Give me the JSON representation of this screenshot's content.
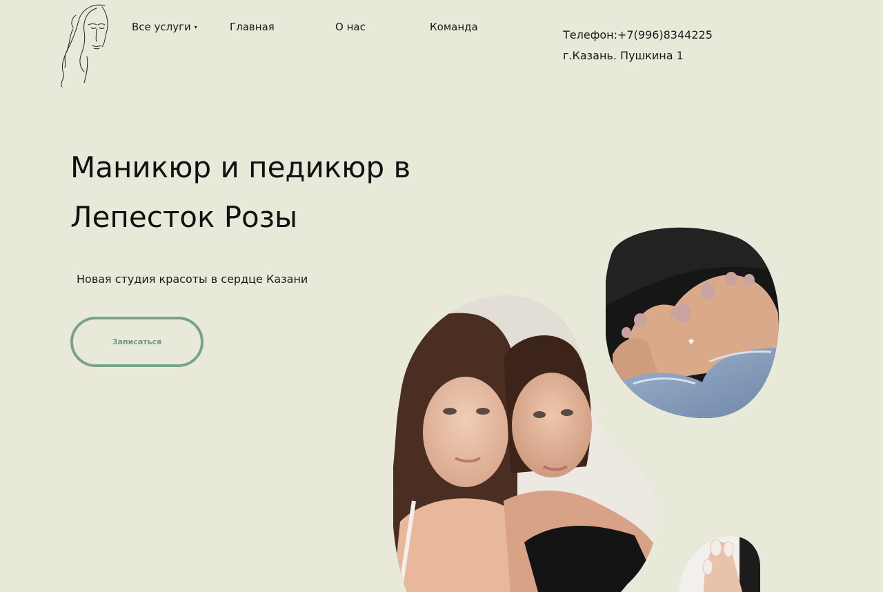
{
  "header": {
    "logo_icon": "face-line-art-logo",
    "nav": {
      "services_label": "Все услуги",
      "services_caret": "▾",
      "home_label": "Главная",
      "about_label": "О нас",
      "team_label": "Команда"
    },
    "contact": {
      "phone": "Телефон:+7(996)8344225",
      "address": "г.Казань. Пушкина 1"
    }
  },
  "hero": {
    "title_line1": "Маникюр и педикюр в",
    "title_line2": "Лепесток Розы",
    "subtitle": "Новая студия красоты в сердце Казани",
    "cta_label": "Записаться"
  },
  "images": [
    {
      "name": "pedicure-photo",
      "shape": "blob"
    },
    {
      "name": "models-photo",
      "shape": "blob"
    },
    {
      "name": "manicure-photo",
      "shape": "blob"
    }
  ],
  "colors": {
    "background": "#e8e9d9",
    "accent": "#7aa18a",
    "text": "#1a1a1a"
  }
}
